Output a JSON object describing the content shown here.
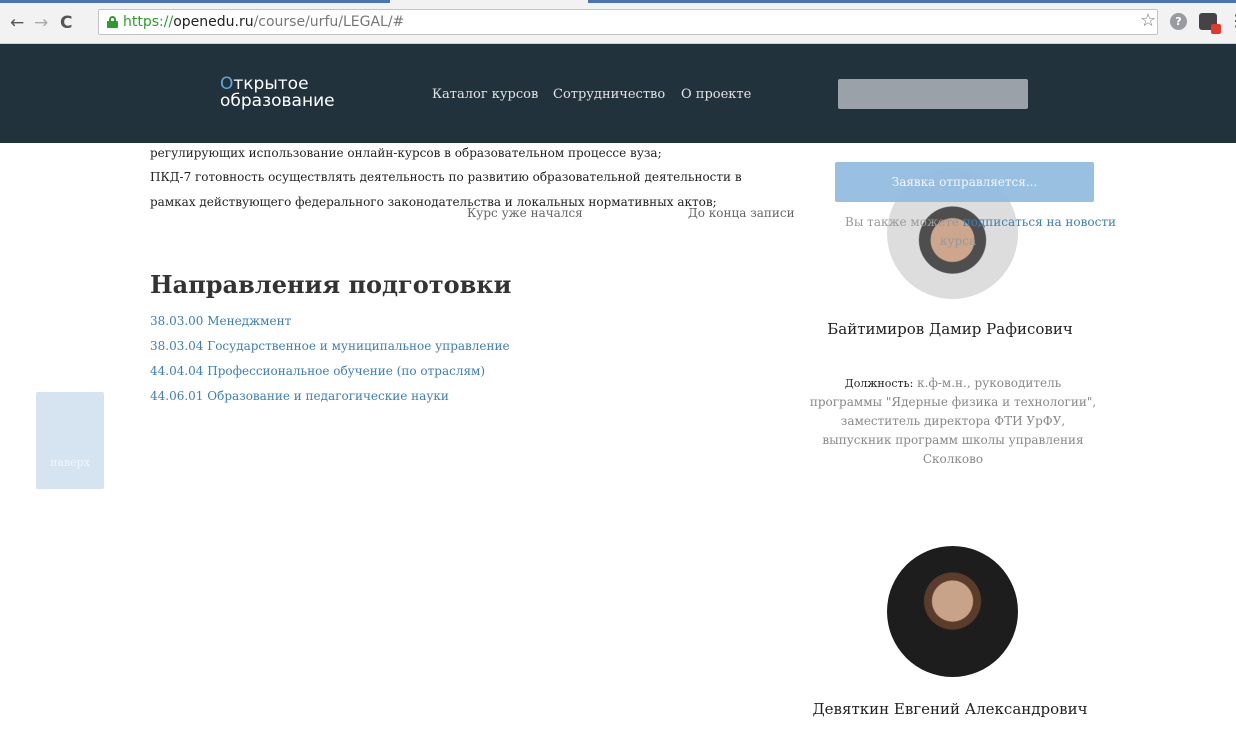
{
  "browser": {
    "back": "←",
    "forward": "→",
    "reload": "C",
    "url_scheme": "https://",
    "url_host": "openedu.ru",
    "url_path": "/course/urfu/LEGAL/#",
    "star": "☆",
    "help": "?",
    "menu": "⋮"
  },
  "header": {
    "logo_first_letter": "О",
    "logo_line1_rest": "ткрытое",
    "logo_line2": "образование",
    "nav": [
      "Каталог курсов",
      "Сотрудничество",
      "О проекте"
    ]
  },
  "content": {
    "lines": [
      "регулирующих использование онлайн-курсов в образовательном процессе вуза;",
      "ПКД-7 готовность осуществлять деятельность по развитию образовательной деятельности в",
      "рамках действующего федерального законодательства и локальных нормативных актов;"
    ],
    "course_started": "Курс уже начался",
    "until_end": "До конца записи",
    "directions_title": "Направления подготовки",
    "directions": [
      "38.03.00 Менеджмент",
      "38.03.04 Государственное и муниципальное управление",
      "44.04.04 Профессиональное обучение (по отраслям)",
      "44.06.01 Образование и педагогические науки"
    ],
    "to_top": "наверх"
  },
  "sidebar": {
    "submit_label": "Заявка отправляется...",
    "subscribe_prefix": "Вы также можете ",
    "subscribe_link": "подписаться на новости",
    "subscribe_suffix": "курса",
    "instructors": [
      {
        "name": "Байтимиров Дамир Рафисович",
        "position_label": "Должность:",
        "position": " к.ф-м.н., руководитель программы \"Ядерные физика и технологии\", заместитель директора ФТИ УрФУ, выпускник программ школы управления Сколково"
      },
      {
        "name": "Девяткин Евгений Александрович"
      }
    ]
  },
  "colors": {
    "header_bg": "#22323d",
    "link": "#3d7fb3",
    "button": "#94bde0"
  }
}
